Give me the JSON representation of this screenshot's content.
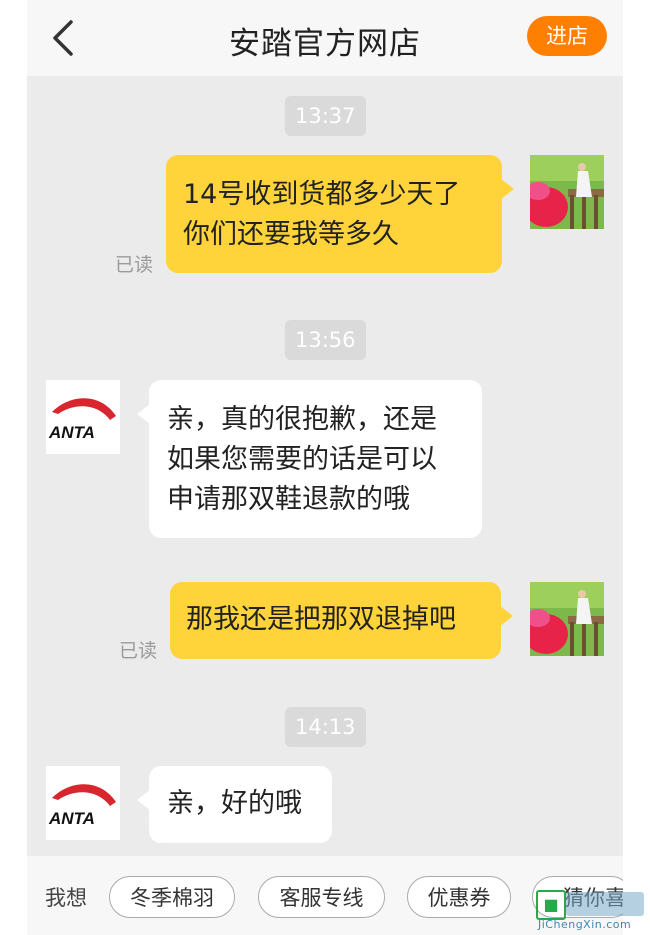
{
  "header": {
    "title": "安踏官方网店",
    "enter_store": "进店"
  },
  "messages": [
    {
      "time": "13:37"
    },
    {
      "line1": "14号收到货都多少天了",
      "line2": "你们还要我等多久",
      "status": "已读"
    },
    {
      "time": "13:56"
    },
    {
      "line1": "亲，真的很抱歉，还是",
      "line2": "如果您需要的话是可以",
      "line3": "申请那双鞋退款的哦"
    },
    {
      "line1": "那我还是把那双退掉吧",
      "status": "已读"
    },
    {
      "time": "14:13"
    },
    {
      "line1": "亲，好的哦"
    }
  ],
  "store_logo_text": "ANTA",
  "quick_replies": {
    "label": "我想",
    "items": [
      "冬季棉羽",
      "客服专线",
      "优惠券",
      "猜你喜"
    ]
  },
  "watermark": {
    "text": "JiChengXin.com"
  },
  "colors": {
    "accent": "#ff7f00",
    "my_bubble": "#ffd43b",
    "their_bubble": "#ffffff",
    "background": "#ebebeb",
    "brand_red": "#d8262f"
  }
}
